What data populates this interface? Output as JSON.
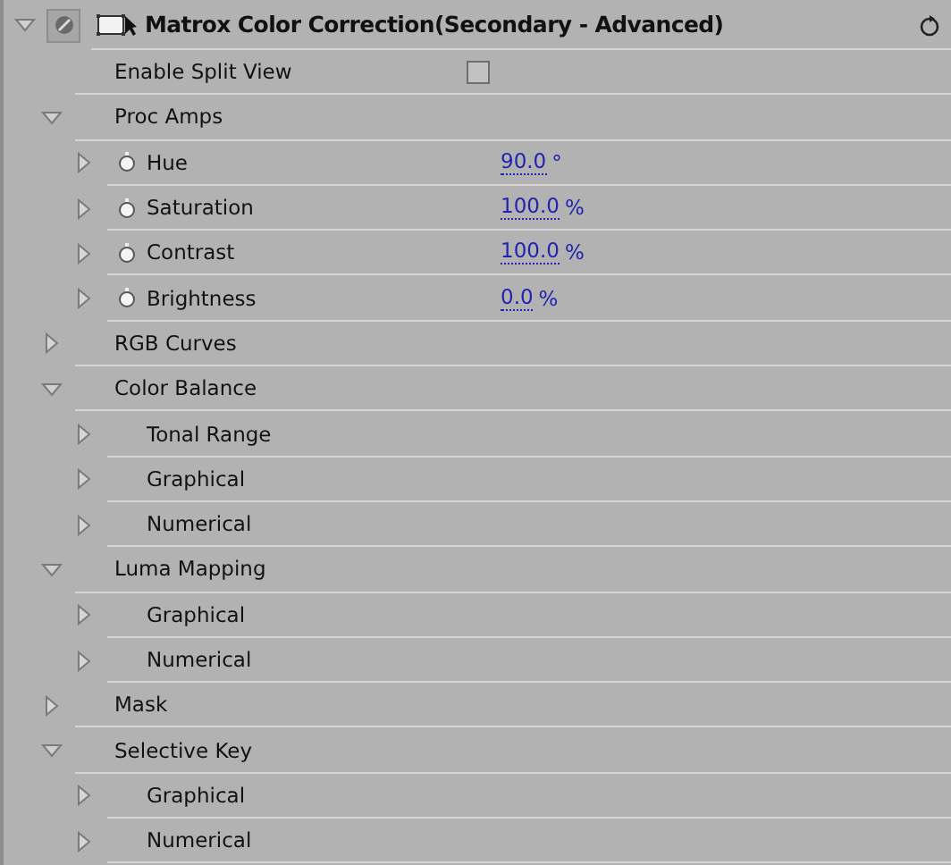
{
  "effect": {
    "title": "Matrox Color Correction(Secondary - Advanced)",
    "expanded": true,
    "enabled": true,
    "children": [
      {
        "kind": "checkbox",
        "label": "Enable Split View",
        "checked": false
      },
      {
        "kind": "group",
        "label": "Proc Amps",
        "expanded": true,
        "children": [
          {
            "kind": "param",
            "label": "Hue",
            "value": "90.0",
            "unit": "°",
            "expanded": false
          },
          {
            "kind": "param",
            "label": "Saturation",
            "value": "100.0",
            "unit": "%",
            "expanded": false
          },
          {
            "kind": "param",
            "label": "Contrast",
            "value": "100.0",
            "unit": "%",
            "expanded": false
          },
          {
            "kind": "param",
            "label": "Brightness",
            "value": "0.0",
            "unit": "%",
            "expanded": false
          }
        ]
      },
      {
        "kind": "group",
        "label": "RGB Curves",
        "expanded": false
      },
      {
        "kind": "group",
        "label": "Color Balance",
        "expanded": true,
        "children": [
          {
            "kind": "group",
            "label": "Tonal Range",
            "expanded": false
          },
          {
            "kind": "group",
            "label": "Graphical",
            "expanded": false
          },
          {
            "kind": "group",
            "label": "Numerical",
            "expanded": false
          }
        ]
      },
      {
        "kind": "group",
        "label": "Luma Mapping",
        "expanded": true,
        "children": [
          {
            "kind": "group",
            "label": "Graphical",
            "expanded": false
          },
          {
            "kind": "group",
            "label": "Numerical",
            "expanded": false
          }
        ]
      },
      {
        "kind": "group",
        "label": "Mask",
        "expanded": false
      },
      {
        "kind": "group",
        "label": "Selective Key",
        "expanded": true,
        "children": [
          {
            "kind": "group",
            "label": "Graphical",
            "expanded": false
          },
          {
            "kind": "group",
            "label": "Numerical",
            "expanded": false
          }
        ]
      }
    ]
  }
}
